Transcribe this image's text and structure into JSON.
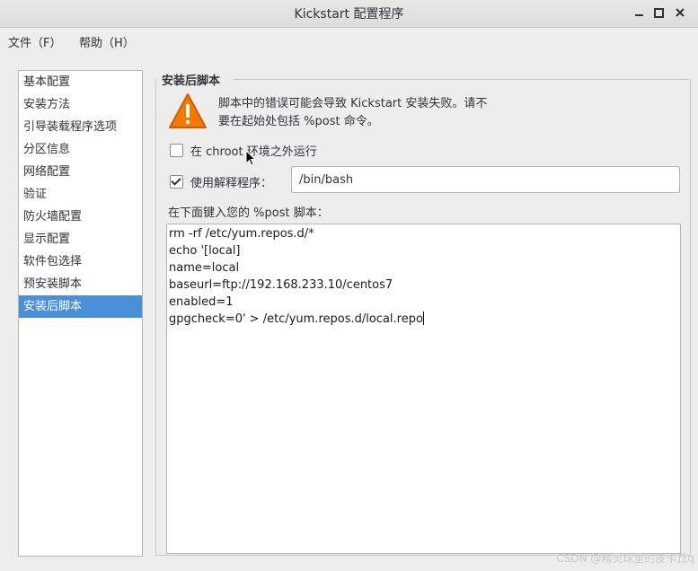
{
  "window": {
    "title": "Kickstart 配置程序",
    "minimize_icon": "minimize-icon",
    "maximize_icon": "maximize-icon",
    "close_icon": "close-icon"
  },
  "menubar": {
    "file": "文件（F）",
    "help": "帮助（H）"
  },
  "sidebar": {
    "items": [
      {
        "label": "基本配置"
      },
      {
        "label": "安装方法"
      },
      {
        "label": "引导装载程序选项"
      },
      {
        "label": "分区信息"
      },
      {
        "label": "网络配置"
      },
      {
        "label": "验证"
      },
      {
        "label": "防火墙配置"
      },
      {
        "label": "显示配置"
      },
      {
        "label": "软件包选择"
      },
      {
        "label": "预安装脚本"
      },
      {
        "label": "安装后脚本"
      }
    ],
    "selected_index": 10
  },
  "panel": {
    "section_title": "安装后脚本",
    "warning_icon": "warning-icon",
    "warning_line1": "脚本中的错误可能会导致 Kickstart 安装失败。请不",
    "warning_line2": "要在起始处包括 %post 命令。",
    "chroot_label": "在 chroot 环境之外运行",
    "chroot_checked": false,
    "interpreter_label": "使用解释程序：",
    "interpreter_checked": true,
    "interpreter_value": "/bin/bash",
    "script_label": "在下面键入您的 %post 脚本：",
    "script_lines": [
      "rm -rf /etc/yum.repos.d/*",
      "echo '[local]",
      "name=local",
      "baseurl=ftp://192.168.233.10/centos7",
      "enabled=1",
      "gpgcheck=0' > /etc/yum.repos.d/local.repo"
    ]
  },
  "watermark": "CSDN @精灵球里的皮卡丘q"
}
